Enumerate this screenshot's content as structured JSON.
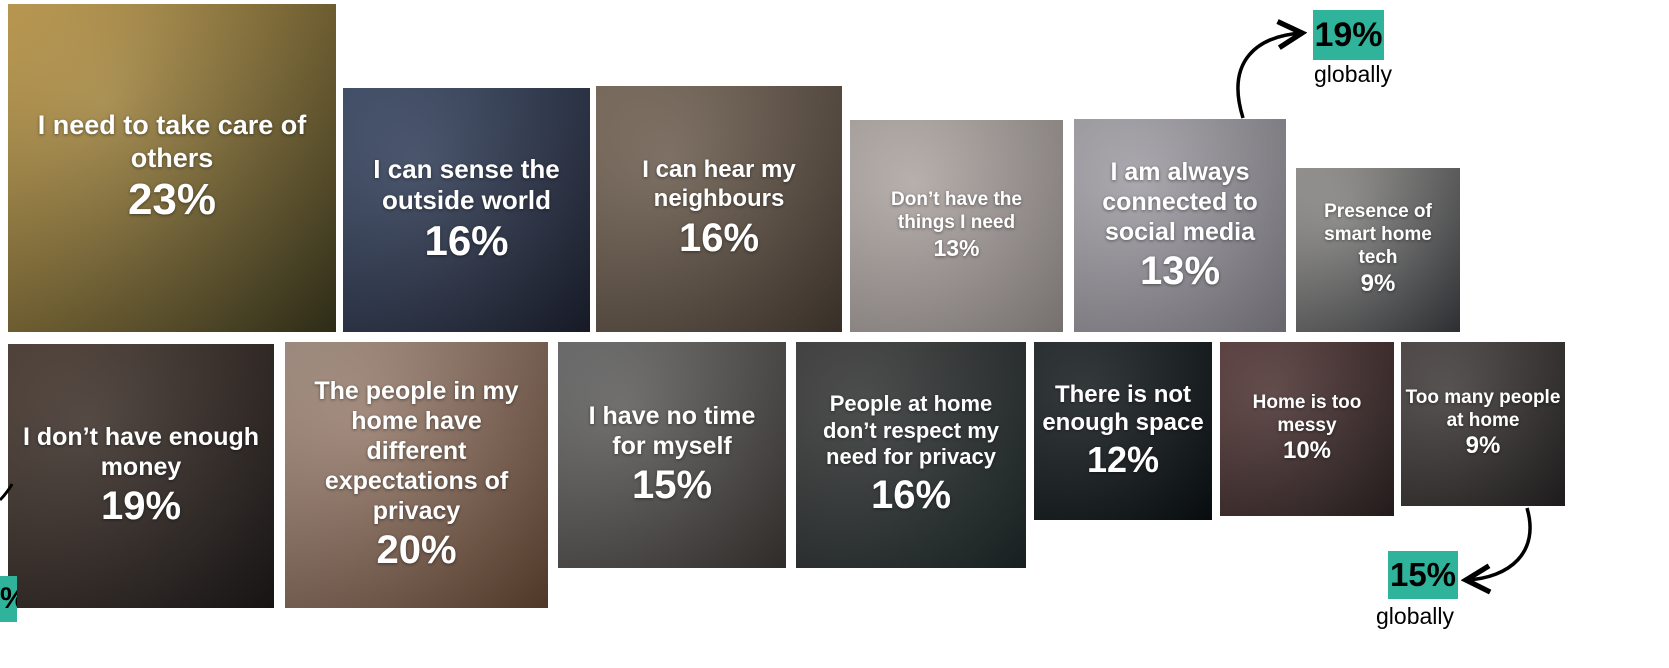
{
  "tiles": [
    {
      "label": "I need to take care of others",
      "percent": "23%",
      "colors": [
        "#c8a04a",
        "#3c3a1e"
      ]
    },
    {
      "label": "I can sense the outside world",
      "percent": "16%",
      "colors": [
        "#3a4a68",
        "#1e2232"
      ]
    },
    {
      "label": "I can hear my neighbours",
      "percent": "16%",
      "colors": [
        "#7a6a5a",
        "#4a3e34"
      ]
    },
    {
      "label": "Don’t have the things I need",
      "percent": "13%",
      "colors": [
        "#b4aca8",
        "#9c9492"
      ]
    },
    {
      "label": "I am always connected to social media",
      "percent": "13%",
      "colors": [
        "#a8a6ac",
        "#8a8890"
      ]
    },
    {
      "label": "Presence of smart home tech",
      "percent": "9%",
      "colors": [
        "#9a9894",
        "#3c3e42"
      ]
    },
    {
      "label": "I don’t have enough money",
      "percent": "19%",
      "colors": [
        "#4a3a30",
        "#1e1a1a"
      ]
    },
    {
      "label": "The people in my home have different expectations of privacy",
      "percent": "20%",
      "colors": [
        "#a89082",
        "#6a4a36"
      ]
    },
    {
      "label": "I have no time for myself",
      "percent": "15%",
      "colors": [
        "#6a6a6a",
        "#3e3a36"
      ]
    },
    {
      "label": "People at home don’t respect my need for privacy",
      "percent": "16%",
      "colors": [
        "#3c3a3a",
        "#1e2a2a"
      ]
    },
    {
      "label": "There is not enough space",
      "percent": "12%",
      "colors": [
        "#1e2426",
        "#0a1014"
      ]
    },
    {
      "label": "Home is too messy",
      "percent": "10%",
      "colors": [
        "#5a3a3a",
        "#2e2424"
      ]
    },
    {
      "label": "Too many people at home",
      "percent": "9%",
      "colors": [
        "#4a4442",
        "#262424"
      ]
    }
  ],
  "callouts": [
    {
      "percent": "19%",
      "label": "globally"
    },
    {
      "percent": "15%",
      "label": "globally"
    },
    {
      "percent": "%"
    }
  ],
  "colors": {
    "accent": "#2fb39b"
  }
}
